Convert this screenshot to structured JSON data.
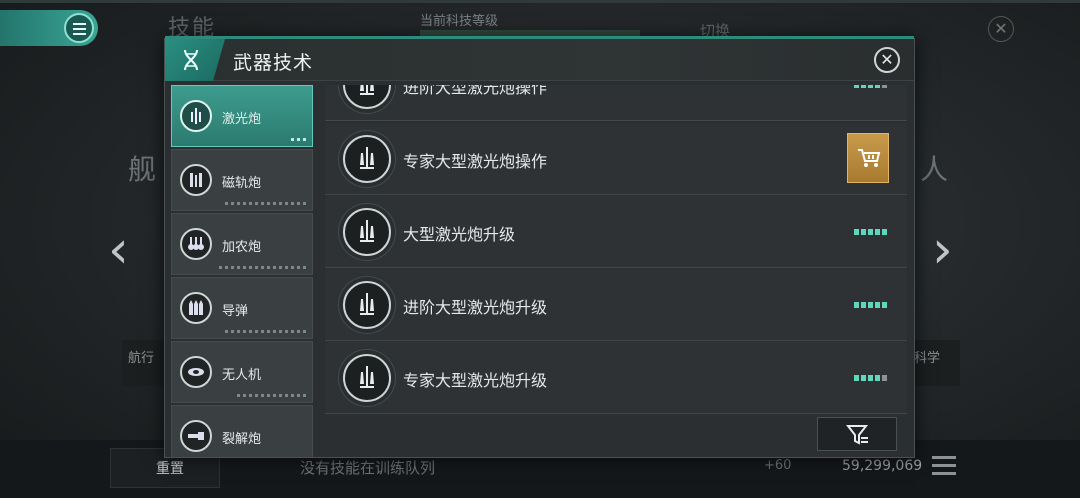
{
  "background": {
    "skill_title": "技能",
    "tech_level_label": "当前科技等级",
    "switch_label": "切换",
    "big_left_text": "舰",
    "big_right_text": "人",
    "card_left_text": "航行",
    "card_right_text": "科学",
    "bottom": {
      "reset_label": "重置",
      "queue_text": "没有技能在训练队列",
      "plus_value": "+60",
      "credits": "59,299,069"
    }
  },
  "modal": {
    "title": "武器技术",
    "close_symbol": "✕",
    "sidebar": [
      {
        "label": "激光炮",
        "active": true
      },
      {
        "label": "磁轨炮",
        "active": false
      },
      {
        "label": "加农炮",
        "active": false
      },
      {
        "label": "导弹",
        "active": false
      },
      {
        "label": "无人机",
        "active": false
      },
      {
        "label": "裂解炮",
        "active": false
      }
    ],
    "skills": [
      {
        "label": "进阶大型激光炮操作",
        "level": 4,
        "max_level": 5,
        "purchasable": false
      },
      {
        "label": "专家大型激光炮操作",
        "level": 0,
        "max_level": 5,
        "purchasable": true
      },
      {
        "label": "大型激光炮升级",
        "level": 5,
        "max_level": 5,
        "purchasable": false
      },
      {
        "label": "进阶大型激光炮升级",
        "level": 5,
        "max_level": 5,
        "purchasable": false
      },
      {
        "label": "专家大型激光炮升级",
        "level": 4,
        "max_level": 5,
        "purchasable": false
      }
    ],
    "icons": {
      "header": "dna-icon",
      "close": "close-icon",
      "buy": "cart-icon",
      "filter": "filter-icon"
    }
  },
  "colors": {
    "accent": "#3aa596",
    "level_on": "#5fd7bd",
    "level_off": "#8d9395",
    "buy": "#c89a4a"
  }
}
